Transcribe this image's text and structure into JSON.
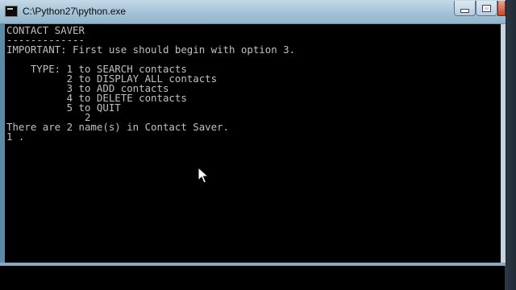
{
  "window": {
    "title": "C:\\Python27\\python.exe"
  },
  "console": {
    "lines": [
      "CONTACT SAVER",
      "-------------",
      "IMPORTANT: First use should begin with option 3.",
      "",
      "    TYPE: 1 to SEARCH contacts",
      "          2 to DISPLAY ALL contacts",
      "          3 to ADD contacts",
      "          4 to DELETE contacts",
      "          5 to QUIT",
      "             2",
      "There are 2 name(s) in Contact Saver.",
      "1 ."
    ]
  },
  "icons": {
    "app": "console-app-icon",
    "minimize": "minimize-icon",
    "maximize": "maximize-icon",
    "close": "close-icon",
    "pointer": "mouse-pointer-icon"
  }
}
